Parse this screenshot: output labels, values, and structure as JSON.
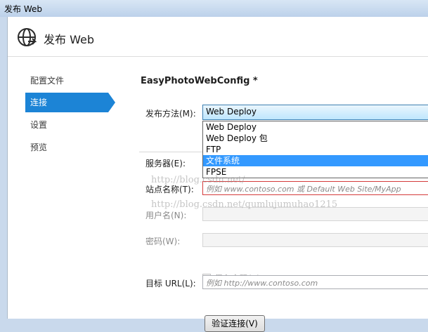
{
  "window": {
    "title": "发布 Web"
  },
  "dialog": {
    "header_title": "发布 Web",
    "profile_name": "EasyPhotoWebConfig *"
  },
  "nav": {
    "items": [
      {
        "label": "配置文件"
      },
      {
        "label": "连接"
      },
      {
        "label": "设置"
      },
      {
        "label": "预览"
      }
    ],
    "selected_index": 1
  },
  "connection": {
    "method_label": "发布方法(M):",
    "method_value": "Web Deploy",
    "method_options": [
      "Web Deploy",
      "Web Deploy 包",
      "FTP",
      "文件系统",
      "FPSE"
    ],
    "highlighted_option": "文件系统",
    "server_label": "服务器(E):",
    "site_label": "站点名称(T):",
    "site_placeholder": "例如 www.contoso.com 或 Default Web Site/MyApp",
    "username_label": "用户名(N):",
    "password_label": "密码(W):",
    "save_password_label": "保存密码(S)",
    "target_url_label": "目标 URL(L):",
    "target_url_placeholder": "例如 http://www.contoso.com",
    "validate_button": "验证连接(V)"
  },
  "watermark": {
    "line1": "http://blog.csdn.net/",
    "line2": "http://blog.csdn.net/qumlujumuhao1215"
  },
  "colors": {
    "selection": "#1c84d6",
    "highlight": "#3399ff",
    "error_border": "#d43b3b"
  }
}
